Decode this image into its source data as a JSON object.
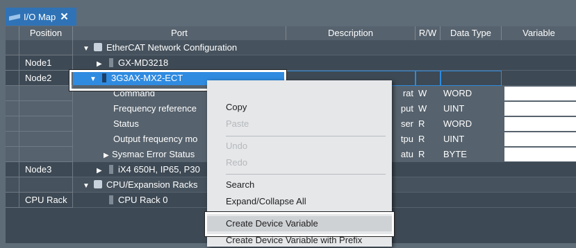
{
  "tab": {
    "label": "I/O Map",
    "close": "✕"
  },
  "columns": [
    "Position",
    "Port",
    "Description",
    "R/W",
    "Data Type",
    "Variable"
  ],
  "rows": [
    {
      "position": "",
      "port": "EtherCAT Network Configuration",
      "tri": "▼"
    },
    {
      "position": "Node1",
      "port": "GX-MD3218",
      "tri": "▶"
    },
    {
      "position": "Node2",
      "port": "3G3AX-MX2-ECT",
      "tri": "▼"
    },
    {
      "position": "",
      "port": "Command",
      "desc": "rat",
      "rw": "W",
      "type": "WORD"
    },
    {
      "position": "",
      "port": "Frequency reference",
      "desc": "put",
      "rw": "W",
      "type": "UINT"
    },
    {
      "position": "",
      "port": "Status",
      "desc": "ser",
      "rw": "R",
      "type": "WORD"
    },
    {
      "position": "",
      "port": "Output frequency mo",
      "desc": "tpu",
      "rw": "R",
      "type": "UINT"
    },
    {
      "position": "",
      "port": "Sysmac Error Status",
      "desc": "atu",
      "rw": "R",
      "type": "BYTE",
      "tri": "▶"
    },
    {
      "position": "Node3",
      "port": "iX4 650H, IP65, P30",
      "tri": "▶"
    },
    {
      "position": "",
      "port": "CPU/Expansion Racks",
      "tri": "▼"
    },
    {
      "position": "CPU Rack",
      "port": "CPU Rack 0"
    }
  ],
  "menu": {
    "copy": "Copy",
    "paste": "Paste",
    "undo": "Undo",
    "redo": "Redo",
    "search": "Search",
    "expand": "Expand/Collapse All",
    "create": "Create Device Variable",
    "create_prefix": "Create Device Variable with Prefix"
  },
  "colors": {
    "accent": "#2f73b6",
    "selection": "#2f8be0",
    "highlight_border": "#ffffff"
  }
}
